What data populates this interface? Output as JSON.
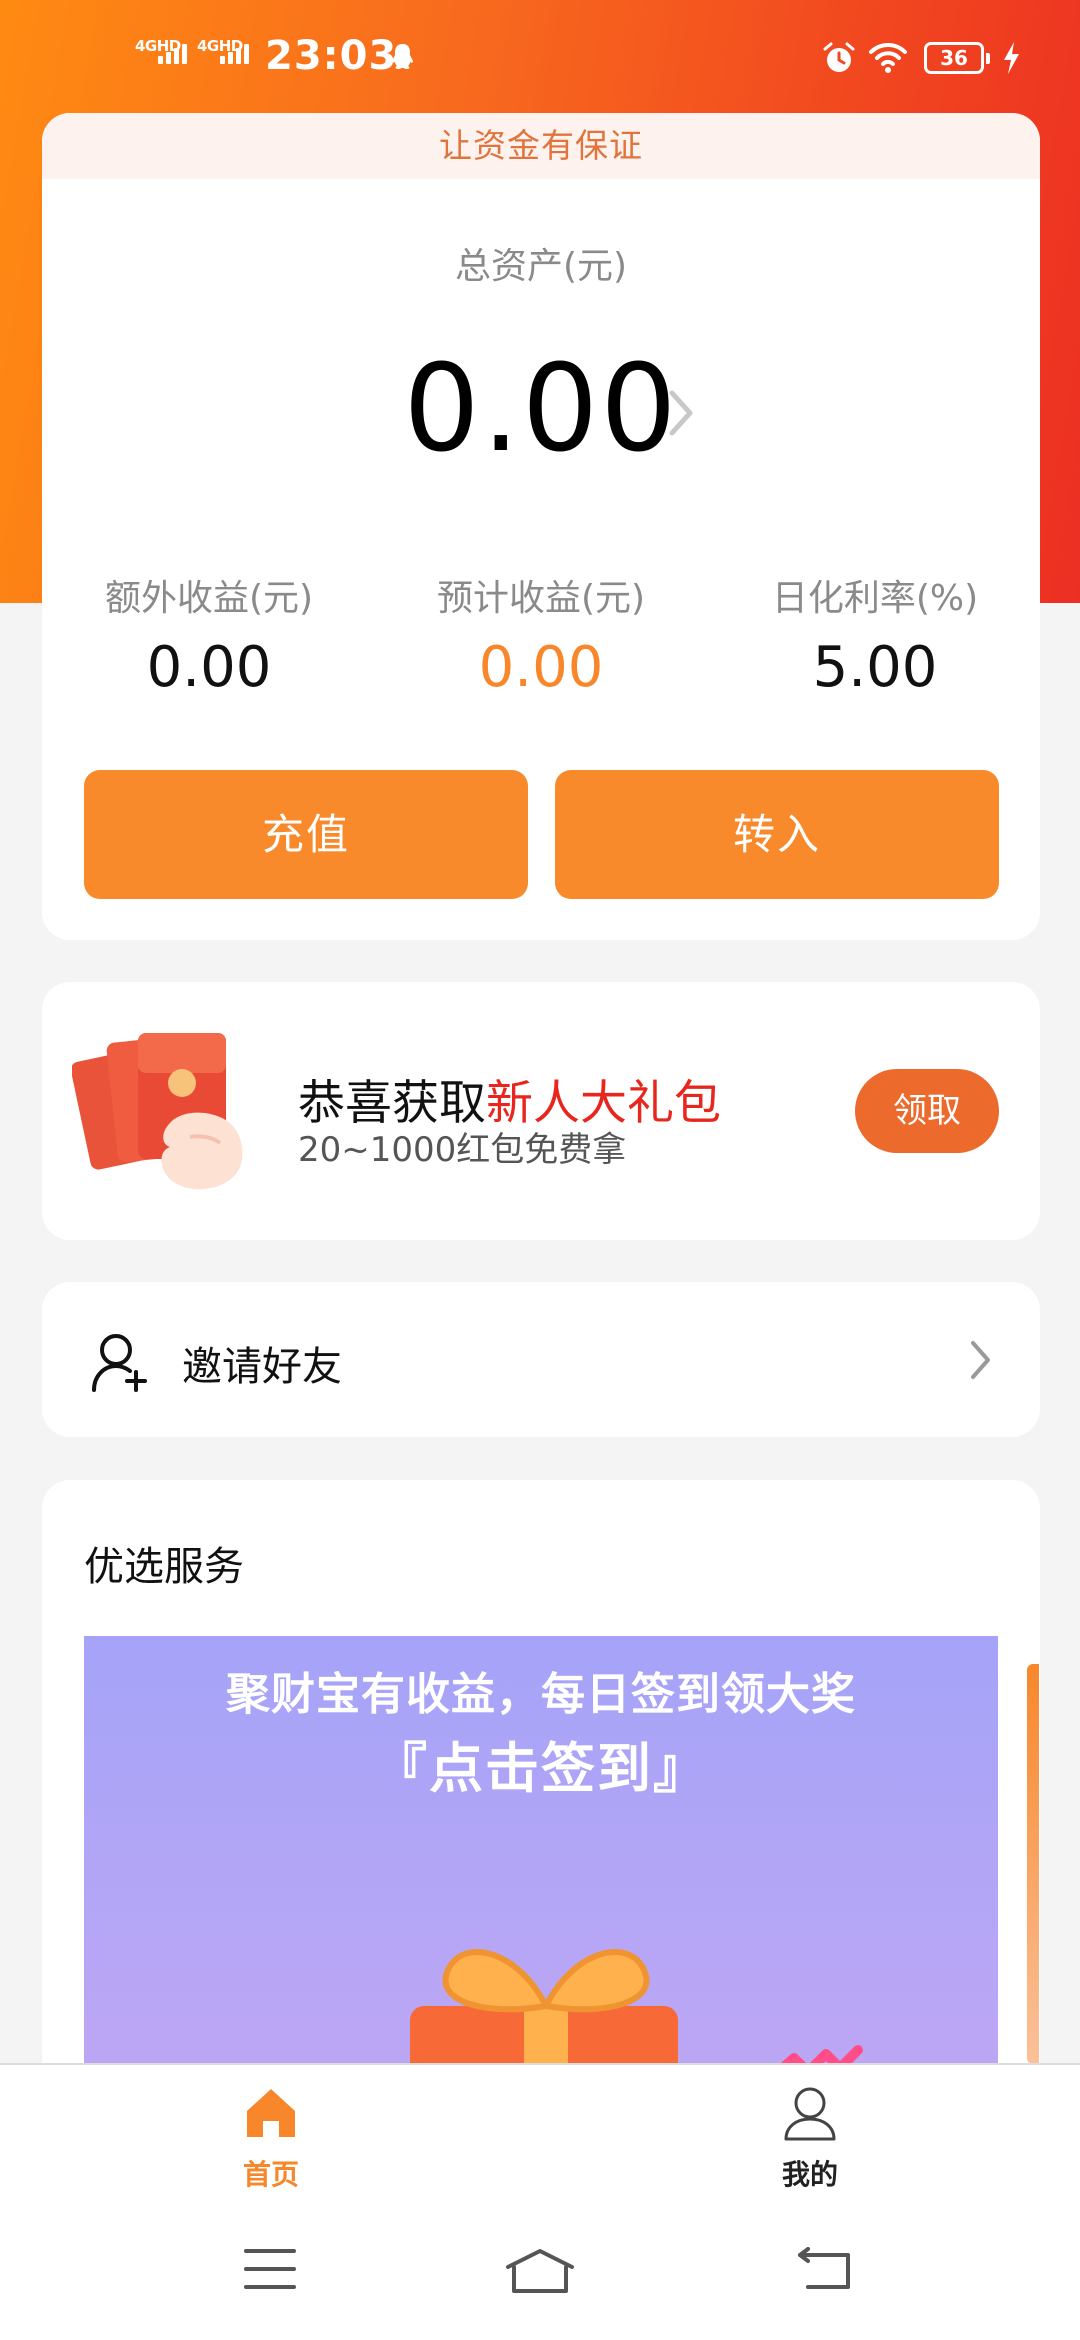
{
  "status_bar": {
    "network1": "4GHD",
    "network2": "4GHD",
    "time": "23:03",
    "battery": "36"
  },
  "asset_card": {
    "banner": "让资金有保证",
    "total_label": "总资产(元)",
    "total_value": "0.00",
    "metrics": [
      {
        "label": "额外收益(元)",
        "value": "0.00"
      },
      {
        "label": "预计收益(元)",
        "value": "0.00"
      },
      {
        "label": "日化利率(%)",
        "value": "5.00"
      }
    ],
    "recharge_label": "充值",
    "transfer_label": "转入"
  },
  "gift_card": {
    "title_prefix": "恭喜获取",
    "title_highlight": "新人大礼包",
    "subtitle": "20~1000红包免费拿",
    "claim_label": "领取"
  },
  "invite": {
    "label": "邀请好友"
  },
  "services": {
    "title": "优选服务",
    "promo_line1": "聚财宝有收益，每日签到领大奖",
    "promo_line2": "『点击签到』"
  },
  "tab_bar": {
    "tabs": [
      {
        "label": "首页",
        "icon": "home-icon",
        "active": true
      },
      {
        "label": "我的",
        "icon": "user-icon",
        "active": false
      }
    ]
  },
  "colors": {
    "accent": "#f88a2c",
    "highlight_red": "#e8261d",
    "header_gradient_start": "#ff8a12",
    "header_gradient_end": "#ec2f23"
  }
}
